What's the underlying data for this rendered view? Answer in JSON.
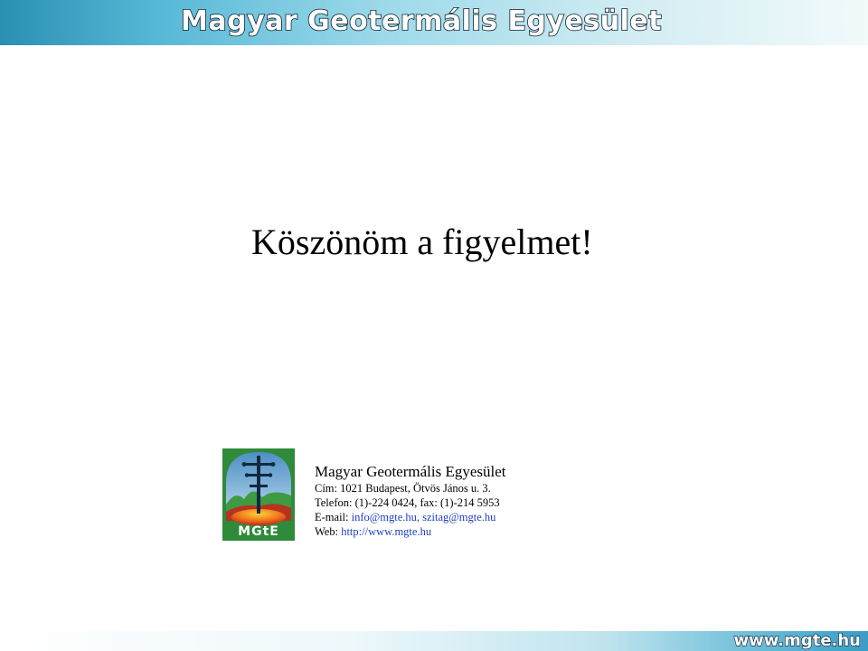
{
  "header": {
    "title": "Magyar Geotermális Egyesület"
  },
  "slide": {
    "thanks": "Köszönöm a figyelmet!"
  },
  "logo": {
    "text": "MGtE"
  },
  "contact": {
    "org_name": "Magyar Geotermális Egyesület",
    "address": "Cím: 1021 Budapest, Ötvös János u. 3.",
    "phone": "Telefon: (1)-224 0424, fax: (1)-214 5953",
    "email_label": "E-mail:",
    "email_value": "info@mgte.hu, szitag@mgte.hu",
    "web_label": "Web:",
    "web_value": "http://www.mgte.hu"
  },
  "footer": {
    "url": "www.mgte.hu"
  },
  "colors": {
    "banner_blue": "#2a8fb4",
    "logo_green": "#2f8a3a",
    "link_blue": "#1f3fbf"
  }
}
